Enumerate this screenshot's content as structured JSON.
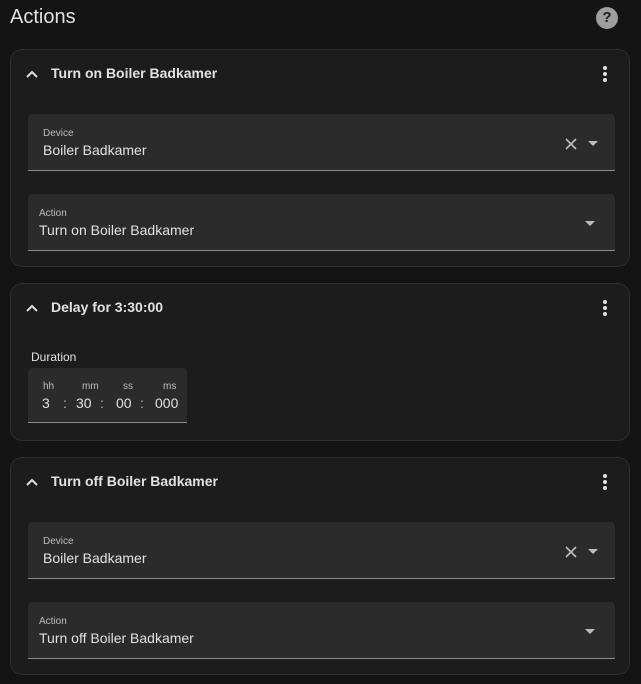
{
  "header": {
    "title": "Actions",
    "help_icon": "help-circle-icon",
    "help_glyph": "?"
  },
  "actions": [
    {
      "title": "Turn on Boiler Badkamer",
      "device": {
        "label": "Device",
        "value": "Boiler Badkamer"
      },
      "action": {
        "label": "Action",
        "value": "Turn on Boiler Badkamer"
      }
    },
    {
      "title": "Delay for 3:30:00",
      "duration": {
        "label": "Duration",
        "hh_label": "hh",
        "hh": "3",
        "mm_label": "mm",
        "mm": "30",
        "ss_label": "ss",
        "ss": "00",
        "ms_label": "ms",
        "ms": "000",
        "separator": ":"
      }
    },
    {
      "title": "Turn off Boiler Badkamer",
      "device": {
        "label": "Device",
        "value": "Boiler Badkamer"
      },
      "action": {
        "label": "Action",
        "value": "Turn off Boiler Badkamer"
      }
    }
  ],
  "colors": {
    "background": "#141414",
    "card": "#1c1c1c",
    "field": "#2b2b2b",
    "text": "#e1e1e1"
  }
}
